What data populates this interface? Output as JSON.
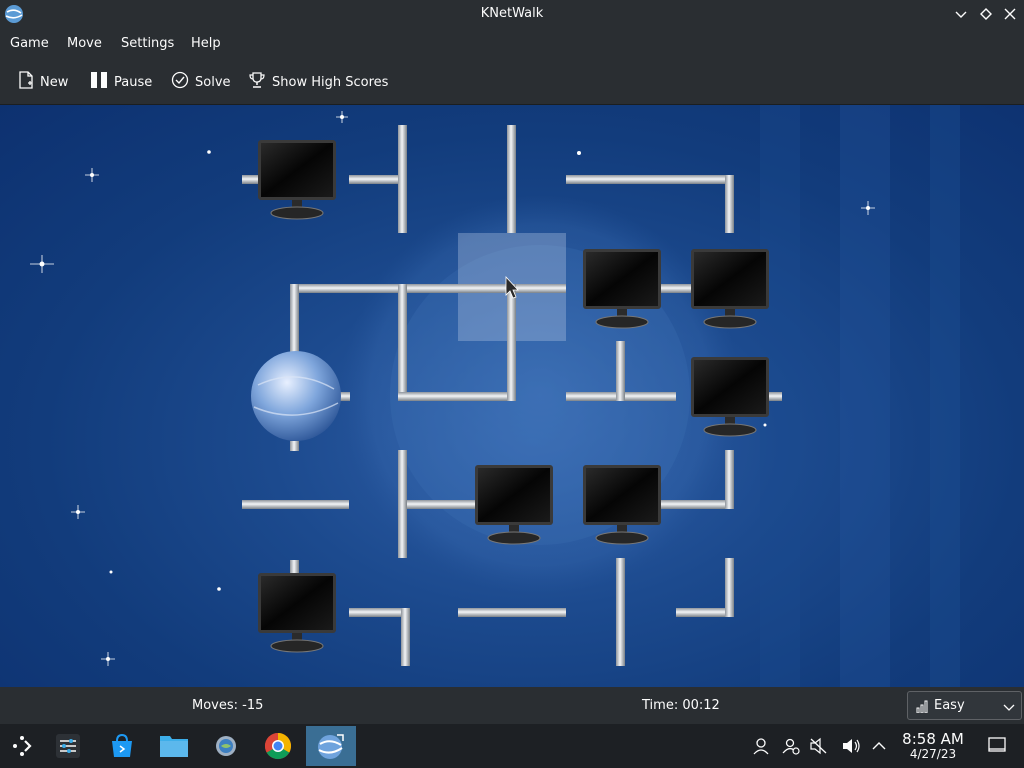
{
  "window": {
    "title": "KNetWalk"
  },
  "menu": [
    "Game",
    "Move",
    "Settings",
    "Help"
  ],
  "toolbar": {
    "new_label": "New",
    "pause_label": "Pause",
    "solve_label": "Solve",
    "highscores_label": "Show High Scores"
  },
  "status": {
    "moves": "Moves: -15",
    "time": "Time: 00:12",
    "difficulty": "Easy"
  },
  "taskbar": {
    "apps": [
      "launcher-icon",
      "system-settings-icon",
      "discover-icon",
      "file-manager-icon",
      "settings-gear-icon",
      "chrome-icon",
      "knetwalk-icon"
    ],
    "active_app": "knetwalk-icon"
  },
  "clock": {
    "time": "8:58 AM",
    "date": "4/27/23"
  },
  "colors": {
    "accent": "#3daee9",
    "board": "#123c7c",
    "pipe": "#c8ccd2"
  }
}
